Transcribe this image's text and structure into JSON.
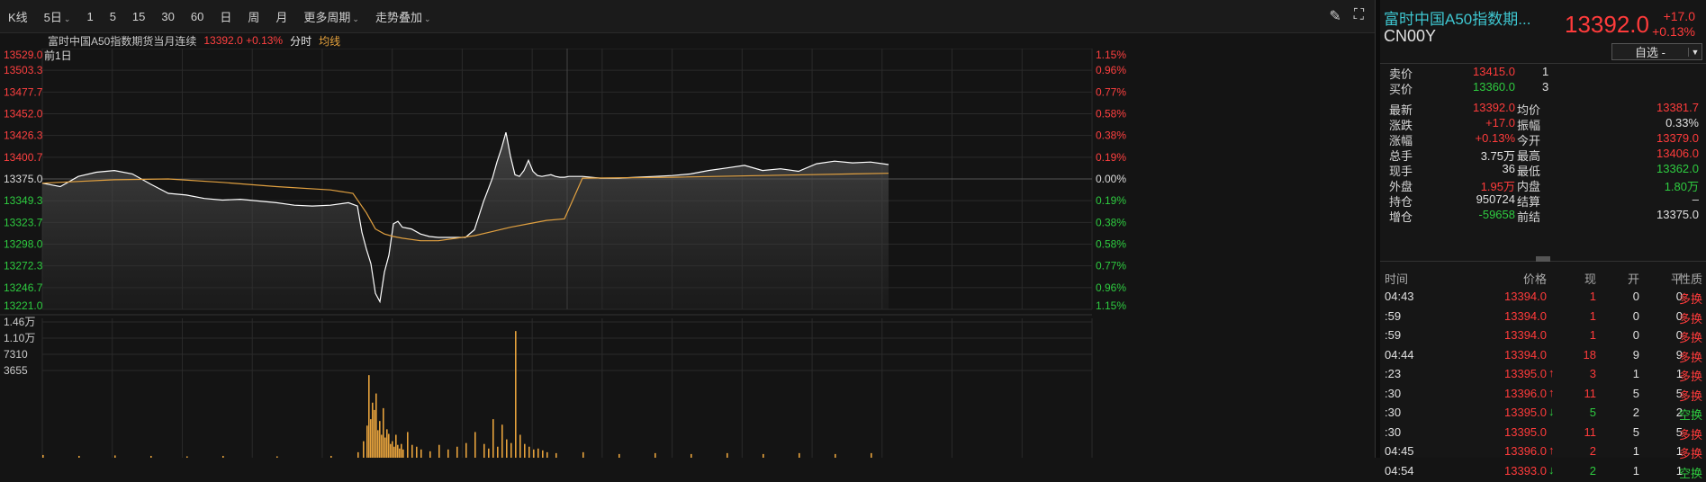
{
  "toolbar": {
    "items": [
      {
        "label": "K线"
      },
      {
        "label": "5日",
        "dropdown": true
      },
      {
        "label": "1"
      },
      {
        "label": "5"
      },
      {
        "label": "15"
      },
      {
        "label": "30"
      },
      {
        "label": "60"
      },
      {
        "label": "日"
      },
      {
        "label": "周"
      },
      {
        "label": "月"
      },
      {
        "label": "更多周期",
        "dropdown": true
      },
      {
        "label": "走势叠加",
        "dropdown": true
      }
    ],
    "tools": [
      {
        "icon": "pen-icon"
      },
      {
        "icon": "fullscreen-icon"
      }
    ]
  },
  "subheader": {
    "name": "富时中国A50指数期货当月连续",
    "price": "13392.0 +0.13%",
    "mode": "分时",
    "avg": "均线"
  },
  "chart_data": {
    "type": "line",
    "period_label": "前1日",
    "y_ticks": [
      "13529.0",
      "13503.3",
      "13477.7",
      "13452.0",
      "13426.3",
      "13400.7",
      "13375.0",
      "13349.3",
      "13323.7",
      "13298.0",
      "13272.3",
      "13246.7",
      "13221.0"
    ],
    "pct_ticks": [
      "1.15%",
      "0.96%",
      "0.77%",
      "0.58%",
      "0.38%",
      "0.19%",
      "0.00%",
      "0.19%",
      "0.38%",
      "0.58%",
      "0.77%",
      "0.96%",
      "1.15%"
    ],
    "ylim": [
      13221.0,
      13529.0
    ],
    "prev_settle": 13375.0,
    "series": [
      {
        "name": "价格",
        "color": "#ffffff",
        "x": [
          0,
          20,
          40,
          60,
          80,
          100,
          120,
          140,
          160,
          180,
          200,
          220,
          240,
          260,
          280,
          300,
          320,
          340,
          350,
          355,
          360,
          365,
          370,
          375,
          380,
          385,
          390,
          395,
          400,
          405,
          410,
          420,
          430,
          440,
          450,
          460,
          470,
          480,
          490,
          500,
          505,
          510,
          515,
          520,
          525,
          530,
          535,
          540,
          545,
          550,
          555,
          560,
          565,
          570,
          575,
          580,
          585,
          590,
          600,
          620,
          640,
          660,
          680,
          700,
          720,
          740,
          760,
          780,
          800,
          820,
          840,
          860,
          880,
          900,
          920,
          940
        ],
        "y": [
          13370,
          13366,
          13378,
          13383,
          13385,
          13381,
          13369,
          13358,
          13356,
          13352,
          13350,
          13351,
          13349,
          13347,
          13344,
          13343,
          13344,
          13347,
          13343,
          13312,
          13292,
          13275,
          13240,
          13230,
          13265,
          13285,
          13322,
          13325,
          13318,
          13317,
          13316,
          13310,
          13307,
          13306,
          13306,
          13306,
          13306,
          13315,
          13348,
          13376,
          13395,
          13411,
          13430,
          13402,
          13380,
          13378,
          13385,
          13397,
          13384,
          13379,
          13378,
          13379,
          13380,
          13378,
          13377,
          13377,
          13378,
          13378,
          13378,
          13376,
          13376,
          13377,
          13378,
          13379,
          13381,
          13385,
          13388,
          13391,
          13385,
          13387,
          13384,
          13393,
          13396,
          13394,
          13395,
          13392
        ]
      },
      {
        "name": "均价",
        "color": "#e0a040",
        "x": [
          0,
          80,
          140,
          200,
          260,
          320,
          345,
          360,
          370,
          380,
          390,
          400,
          420,
          440,
          460,
          480,
          500,
          520,
          540,
          560,
          580,
          600,
          700,
          800,
          900,
          940
        ],
        "y": [
          13370,
          13374,
          13375,
          13371,
          13366,
          13362,
          13358,
          13335,
          13316,
          13310,
          13307,
          13305,
          13302,
          13302,
          13305,
          13308,
          13313,
          13318,
          13322,
          13326,
          13328,
          13376,
          13377,
          13379,
          13381,
          13381.7
        ]
      }
    ],
    "volume": {
      "y_ticks": [
        "1.46万",
        "1.10万",
        "7310",
        "3655"
      ],
      "ymax": 14600,
      "x": [
        0,
        40,
        80,
        120,
        160,
        200,
        260,
        320,
        350,
        356,
        360,
        362,
        364,
        366,
        368,
        370,
        372,
        374,
        376,
        378,
        380,
        382,
        384,
        386,
        388,
        390,
        392,
        394,
        396,
        398,
        400,
        405,
        410,
        415,
        420,
        430,
        440,
        450,
        460,
        470,
        480,
        490,
        495,
        500,
        505,
        510,
        515,
        520,
        525,
        530,
        535,
        540,
        545,
        550,
        555,
        560,
        570,
        600,
        640,
        680,
        720,
        760,
        800,
        840,
        880,
        920
      ],
      "v": [
        300,
        200,
        250,
        200,
        150,
        200,
        150,
        200,
        600,
        1800,
        3500,
        9000,
        4200,
        6000,
        5200,
        7000,
        3000,
        4000,
        2500,
        5400,
        2200,
        3100,
        2600,
        1500,
        1800,
        1200,
        2500,
        1400,
        1000,
        1500,
        900,
        2800,
        1400,
        1200,
        900,
        700,
        1400,
        900,
        1200,
        1600,
        2800,
        1500,
        1000,
        4200,
        1200,
        3600,
        2000,
        1600,
        13800,
        2500,
        1500,
        1200,
        900,
        1000,
        800,
        600,
        500,
        600,
        400,
        500,
        400,
        500,
        400,
        500,
        400,
        500
      ]
    }
  },
  "quote_panel": {
    "name": "富时中国A50指数期...",
    "code": "CN00Y",
    "price": "13392.0",
    "change": "+17.0",
    "change_pct": "+0.13%",
    "watch_label": "自选 -",
    "ask": {
      "label": "卖价",
      "price": "13415.0",
      "vol": "1"
    },
    "bid": {
      "label": "买价",
      "price": "13360.0",
      "vol": "3"
    },
    "stats_left": [
      {
        "label": "最新",
        "value": "13392.0",
        "color": "red"
      },
      {
        "label": "涨跌",
        "value": "+17.0",
        "color": "red"
      },
      {
        "label": "涨幅",
        "value": "+0.13%",
        "color": "red"
      },
      {
        "label": "总手",
        "value": "3.75万",
        "color": "white"
      },
      {
        "label": "现手",
        "value": "36",
        "color": "white"
      },
      {
        "label": "外盘",
        "value": "1.95万",
        "color": "red"
      },
      {
        "label": "持仓",
        "value": "950724",
        "color": "white"
      },
      {
        "label": "增仓",
        "value": "-59658",
        "color": "green"
      }
    ],
    "stats_right": [
      {
        "label": "均价",
        "value": "13381.7",
        "color": "red"
      },
      {
        "label": "振幅",
        "value": "0.33%",
        "color": "white"
      },
      {
        "label": "今开",
        "value": "13379.0",
        "color": "red"
      },
      {
        "label": "最高",
        "value": "13406.0",
        "color": "red"
      },
      {
        "label": "最低",
        "value": "13362.0",
        "color": "green"
      },
      {
        "label": "内盘",
        "value": "1.80万",
        "color": "green"
      },
      {
        "label": "结算",
        "value": "–",
        "color": "white"
      },
      {
        "label": "前结",
        "value": "13375.0",
        "color": "white"
      }
    ]
  },
  "ticks": {
    "headers": [
      "时间",
      "价格",
      "现",
      "开",
      "平",
      "性质"
    ],
    "rows": [
      {
        "time": "04:43",
        "price": "13394.0",
        "dir": "",
        "now": "1",
        "open": "0",
        "close": "0",
        "nature": "多换",
        "nc": "red",
        "pc": "red"
      },
      {
        "time": ":59",
        "price": "13394.0",
        "dir": "",
        "now": "1",
        "open": "0",
        "close": "0",
        "nature": "多换",
        "nc": "red",
        "pc": "red"
      },
      {
        "time": ":59",
        "price": "13394.0",
        "dir": "",
        "now": "1",
        "open": "0",
        "close": "0",
        "nature": "多换",
        "nc": "red",
        "pc": "red"
      },
      {
        "time": "04:44",
        "price": "13394.0",
        "dir": "",
        "now": "18",
        "open": "9",
        "close": "9",
        "nature": "多换",
        "nc": "red",
        "pc": "red"
      },
      {
        "time": ":23",
        "price": "13395.0",
        "dir": "up",
        "now": "3",
        "open": "1",
        "close": "1",
        "nature": "多换",
        "nc": "red",
        "pc": "red"
      },
      {
        "time": ":30",
        "price": "13396.0",
        "dir": "up",
        "now": "11",
        "open": "5",
        "close": "5",
        "nature": "多换",
        "nc": "red",
        "pc": "red"
      },
      {
        "time": ":30",
        "price": "13395.0",
        "dir": "down",
        "now": "5",
        "open": "2",
        "close": "2",
        "nature": "空换",
        "nc": "green",
        "pc": "red"
      },
      {
        "time": ":30",
        "price": "13395.0",
        "dir": "",
        "now": "11",
        "open": "5",
        "close": "5",
        "nature": "多换",
        "nc": "red",
        "pc": "red"
      },
      {
        "time": "04:45",
        "price": "13396.0",
        "dir": "up",
        "now": "2",
        "open": "1",
        "close": "1",
        "nature": "多换",
        "nc": "red",
        "pc": "red"
      },
      {
        "time": "04:54",
        "price": "13393.0",
        "dir": "down",
        "now": "2",
        "open": "1",
        "close": "1",
        "nature": "空换",
        "nc": "green",
        "pc": "red"
      }
    ]
  }
}
